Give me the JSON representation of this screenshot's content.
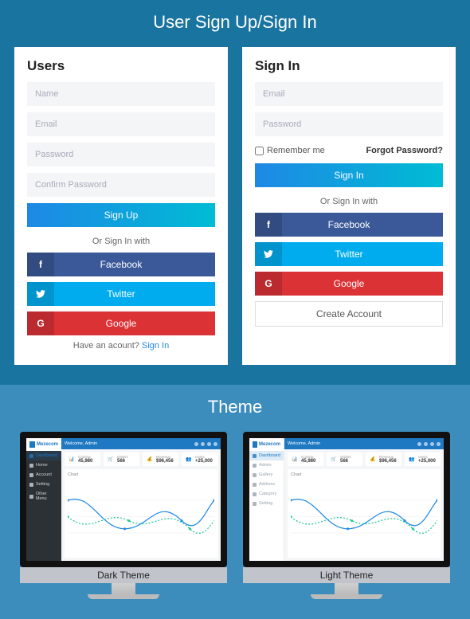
{
  "section1": {
    "title": "User Sign Up/Sign In"
  },
  "signup": {
    "title": "Users",
    "name_ph": "Name",
    "email_ph": "Email",
    "password_ph": "Password",
    "confirm_ph": "Confirm Password",
    "submit": "Sign Up",
    "or_text": "Or Sign In with",
    "facebook": "Facebook",
    "twitter": "Twitter",
    "google": "Google",
    "have_account": "Have an acount? ",
    "signin_link": "Sign In"
  },
  "signin": {
    "title": "Sign In",
    "email_ph": "Email",
    "password_ph": "Password",
    "remember": "Remember me",
    "forgot": "Forgot Password?",
    "submit": "Sign In",
    "or_text": "Or Sign In with",
    "facebook": "Facebook",
    "twitter": "Twitter",
    "google": "Google",
    "create": "Create Account"
  },
  "section2": {
    "title": "Theme"
  },
  "themes": {
    "dark_label": "Dark Theme",
    "light_label": "Light Theme",
    "brand": "Mezecom",
    "topbar_text": "Welcome, Admin",
    "sidebar_items": [
      "Dashboard",
      "Home",
      "Account",
      "Setting",
      "Other Menu"
    ],
    "light_sidebar_items": [
      "Dashboard",
      "Admin",
      "Gallery",
      "Address",
      "Category",
      "Setting"
    ],
    "stats": [
      {
        "label": "Coming",
        "value": "45,980",
        "color": "#e83e8c",
        "glyph": "📊"
      },
      {
        "label": "Orders",
        "value": "566",
        "color": "#f7b500",
        "glyph": "🛒"
      },
      {
        "label": "Revenue",
        "value": "$96,456",
        "color": "#20c997",
        "glyph": "💰"
      },
      {
        "label": "Users",
        "value": "+25,000",
        "color": "#1e88e5",
        "glyph": "👥"
      }
    ],
    "chart_title": "Chart"
  }
}
